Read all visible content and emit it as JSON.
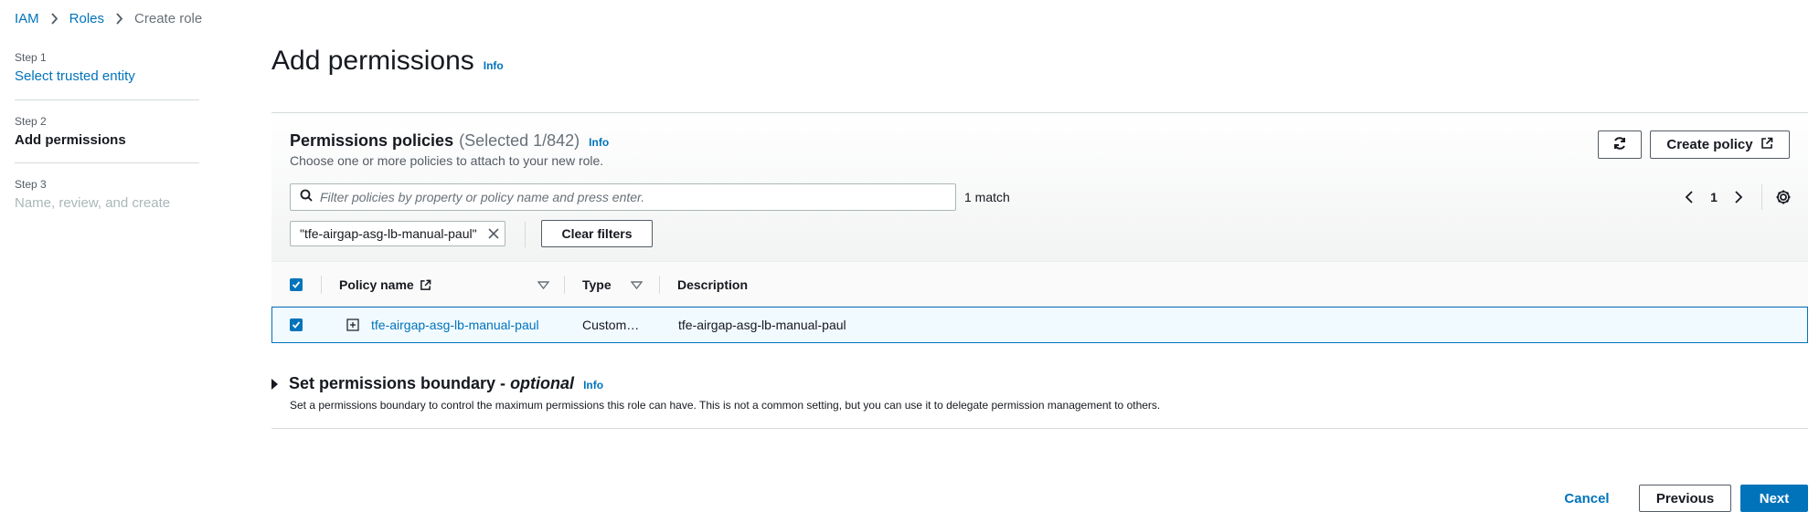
{
  "breadcrumb": {
    "items": [
      "IAM",
      "Roles"
    ],
    "current": "Create role"
  },
  "steps": [
    {
      "num": "Step 1",
      "title": "Select trusted entity"
    },
    {
      "num": "Step 2",
      "title": "Add permissions"
    },
    {
      "num": "Step 3",
      "title": "Name, review, and create"
    }
  ],
  "page": {
    "title": "Add permissions",
    "info": "Info"
  },
  "permissions": {
    "title": "Permissions policies",
    "count": "(Selected 1/842)",
    "info": "Info",
    "description": "Choose one or more policies to attach to your new role.",
    "create_policy_label": "Create policy",
    "refresh_icon": "refresh-icon",
    "filter": {
      "placeholder": "Filter policies by property or policy name and press enter.",
      "value": ""
    },
    "match_count": "1 match",
    "page_number": "1",
    "token": "\"tfe-airgap-asg-lb-manual-paul\"",
    "clear_filters_label": "Clear filters",
    "columns": {
      "name": "Policy name",
      "type": "Type",
      "description": "Description"
    },
    "rows": [
      {
        "name": "tfe-airgap-asg-lb-manual-paul",
        "type": "Custom…",
        "description": "tfe-airgap-asg-lb-manual-paul",
        "selected": true
      }
    ]
  },
  "boundary": {
    "title": "Set permissions boundary - ",
    "optional": "optional",
    "info": "Info",
    "description": "Set a permissions boundary to control the maximum permissions this role can have. This is not a common setting, but you can use it to delegate permission management to others."
  },
  "footer": {
    "cancel": "Cancel",
    "previous": "Previous",
    "next": "Next"
  },
  "colors": {
    "accent": "#0073bb",
    "text": "#16191f",
    "muted": "#687078",
    "selected_row_bg": "#f1faff"
  }
}
